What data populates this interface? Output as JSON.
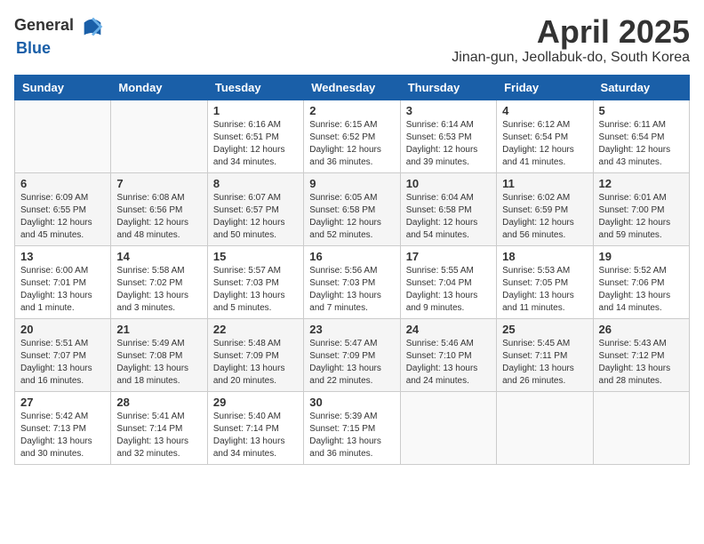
{
  "header": {
    "logo_general": "General",
    "logo_blue": "Blue",
    "month": "April 2025",
    "location": "Jinan-gun, Jeollabuk-do, South Korea"
  },
  "weekdays": [
    "Sunday",
    "Monday",
    "Tuesday",
    "Wednesday",
    "Thursday",
    "Friday",
    "Saturday"
  ],
  "weeks": [
    [
      {
        "day": "",
        "info": ""
      },
      {
        "day": "",
        "info": ""
      },
      {
        "day": "1",
        "info": "Sunrise: 6:16 AM\nSunset: 6:51 PM\nDaylight: 12 hours\nand 34 minutes."
      },
      {
        "day": "2",
        "info": "Sunrise: 6:15 AM\nSunset: 6:52 PM\nDaylight: 12 hours\nand 36 minutes."
      },
      {
        "day": "3",
        "info": "Sunrise: 6:14 AM\nSunset: 6:53 PM\nDaylight: 12 hours\nand 39 minutes."
      },
      {
        "day": "4",
        "info": "Sunrise: 6:12 AM\nSunset: 6:54 PM\nDaylight: 12 hours\nand 41 minutes."
      },
      {
        "day": "5",
        "info": "Sunrise: 6:11 AM\nSunset: 6:54 PM\nDaylight: 12 hours\nand 43 minutes."
      }
    ],
    [
      {
        "day": "6",
        "info": "Sunrise: 6:09 AM\nSunset: 6:55 PM\nDaylight: 12 hours\nand 45 minutes."
      },
      {
        "day": "7",
        "info": "Sunrise: 6:08 AM\nSunset: 6:56 PM\nDaylight: 12 hours\nand 48 minutes."
      },
      {
        "day": "8",
        "info": "Sunrise: 6:07 AM\nSunset: 6:57 PM\nDaylight: 12 hours\nand 50 minutes."
      },
      {
        "day": "9",
        "info": "Sunrise: 6:05 AM\nSunset: 6:58 PM\nDaylight: 12 hours\nand 52 minutes."
      },
      {
        "day": "10",
        "info": "Sunrise: 6:04 AM\nSunset: 6:58 PM\nDaylight: 12 hours\nand 54 minutes."
      },
      {
        "day": "11",
        "info": "Sunrise: 6:02 AM\nSunset: 6:59 PM\nDaylight: 12 hours\nand 56 minutes."
      },
      {
        "day": "12",
        "info": "Sunrise: 6:01 AM\nSunset: 7:00 PM\nDaylight: 12 hours\nand 59 minutes."
      }
    ],
    [
      {
        "day": "13",
        "info": "Sunrise: 6:00 AM\nSunset: 7:01 PM\nDaylight: 13 hours\nand 1 minute."
      },
      {
        "day": "14",
        "info": "Sunrise: 5:58 AM\nSunset: 7:02 PM\nDaylight: 13 hours\nand 3 minutes."
      },
      {
        "day": "15",
        "info": "Sunrise: 5:57 AM\nSunset: 7:03 PM\nDaylight: 13 hours\nand 5 minutes."
      },
      {
        "day": "16",
        "info": "Sunrise: 5:56 AM\nSunset: 7:03 PM\nDaylight: 13 hours\nand 7 minutes."
      },
      {
        "day": "17",
        "info": "Sunrise: 5:55 AM\nSunset: 7:04 PM\nDaylight: 13 hours\nand 9 minutes."
      },
      {
        "day": "18",
        "info": "Sunrise: 5:53 AM\nSunset: 7:05 PM\nDaylight: 13 hours\nand 11 minutes."
      },
      {
        "day": "19",
        "info": "Sunrise: 5:52 AM\nSunset: 7:06 PM\nDaylight: 13 hours\nand 14 minutes."
      }
    ],
    [
      {
        "day": "20",
        "info": "Sunrise: 5:51 AM\nSunset: 7:07 PM\nDaylight: 13 hours\nand 16 minutes."
      },
      {
        "day": "21",
        "info": "Sunrise: 5:49 AM\nSunset: 7:08 PM\nDaylight: 13 hours\nand 18 minutes."
      },
      {
        "day": "22",
        "info": "Sunrise: 5:48 AM\nSunset: 7:09 PM\nDaylight: 13 hours\nand 20 minutes."
      },
      {
        "day": "23",
        "info": "Sunrise: 5:47 AM\nSunset: 7:09 PM\nDaylight: 13 hours\nand 22 minutes."
      },
      {
        "day": "24",
        "info": "Sunrise: 5:46 AM\nSunset: 7:10 PM\nDaylight: 13 hours\nand 24 minutes."
      },
      {
        "day": "25",
        "info": "Sunrise: 5:45 AM\nSunset: 7:11 PM\nDaylight: 13 hours\nand 26 minutes."
      },
      {
        "day": "26",
        "info": "Sunrise: 5:43 AM\nSunset: 7:12 PM\nDaylight: 13 hours\nand 28 minutes."
      }
    ],
    [
      {
        "day": "27",
        "info": "Sunrise: 5:42 AM\nSunset: 7:13 PM\nDaylight: 13 hours\nand 30 minutes."
      },
      {
        "day": "28",
        "info": "Sunrise: 5:41 AM\nSunset: 7:14 PM\nDaylight: 13 hours\nand 32 minutes."
      },
      {
        "day": "29",
        "info": "Sunrise: 5:40 AM\nSunset: 7:14 PM\nDaylight: 13 hours\nand 34 minutes."
      },
      {
        "day": "30",
        "info": "Sunrise: 5:39 AM\nSunset: 7:15 PM\nDaylight: 13 hours\nand 36 minutes."
      },
      {
        "day": "",
        "info": ""
      },
      {
        "day": "",
        "info": ""
      },
      {
        "day": "",
        "info": ""
      }
    ]
  ]
}
